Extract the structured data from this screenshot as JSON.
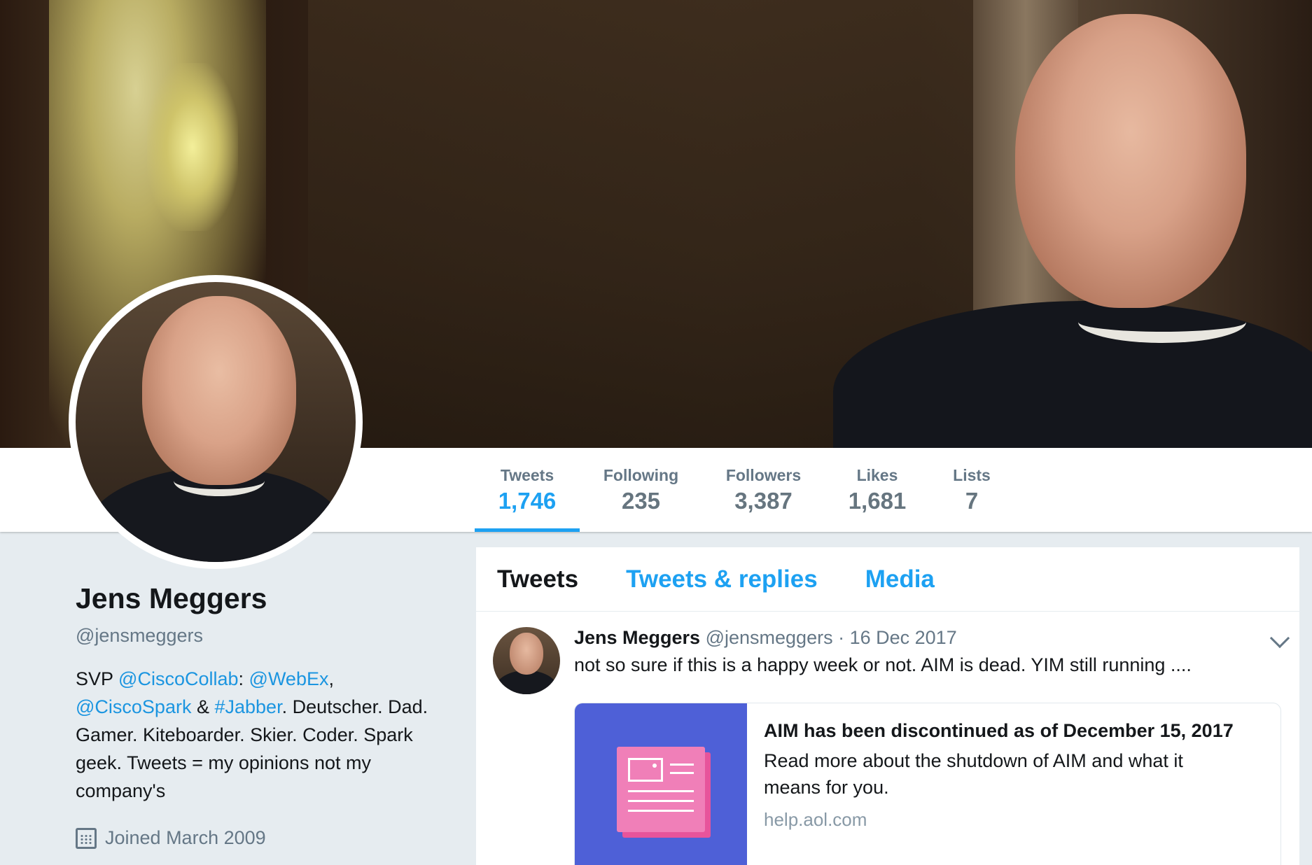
{
  "header": {
    "banner_alt": "profile-banner"
  },
  "stats": [
    {
      "label": "Tweets",
      "value": "1,746",
      "active": true
    },
    {
      "label": "Following",
      "value": "235"
    },
    {
      "label": "Followers",
      "value": "3,387"
    },
    {
      "label": "Likes",
      "value": "1,681"
    },
    {
      "label": "Lists",
      "value": "7"
    }
  ],
  "profile": {
    "name": "Jens Meggers",
    "handle": "@jensmeggers",
    "bio": {
      "p1": "SVP ",
      "m1": "@CiscoCollab",
      "p2": ": ",
      "m2": "@WebEx",
      "p3": ", ",
      "m3": "@CiscoSpark",
      "p4": " & ",
      "m4": "#Jabber",
      "p5": ". Deutscher. Dad. Gamer. Kiteboarder. Skier. Coder. Spark geek. Tweets = my opinions not my company's"
    },
    "joined": "Joined March 2009"
  },
  "timeline": {
    "tabs": [
      {
        "label": "Tweets",
        "active": true
      },
      {
        "label": "Tweets & replies"
      },
      {
        "label": "Media"
      }
    ],
    "tweet": {
      "name": "Jens Meggers",
      "handle": "@jensmeggers",
      "sep": " · ",
      "date": "16 Dec 2017",
      "text": "not so sure if this is a happy week or not. AIM is dead. YIM still running ....",
      "card": {
        "title": "AIM has been discontinued as of December 15, 2017",
        "description": "Read more about the shutdown of AIM and what it means for you.",
        "url": "help.aol.com"
      }
    }
  },
  "colors": {
    "accent": "#1da1f2",
    "card_image_bg": "#4e60d7",
    "doc_pink": "#f07fb8"
  }
}
